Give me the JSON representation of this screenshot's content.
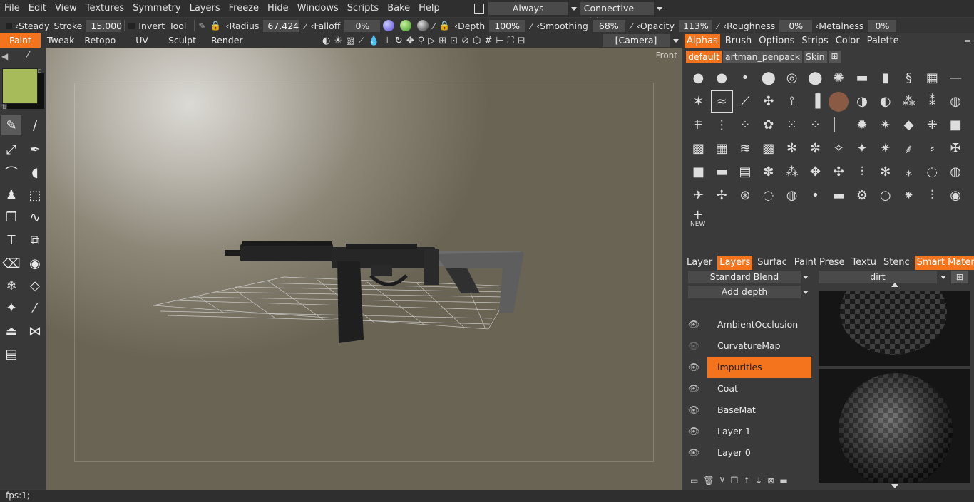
{
  "menubar": {
    "items": [
      "File",
      "Edit",
      "View",
      "Textures",
      "Symmetry",
      "Layers",
      "Freeze",
      "Hide",
      "Windows",
      "Scripts",
      "Bake",
      "Help"
    ],
    "always_label": "Always",
    "connective_label": "Connective Picki"
  },
  "toolbar": {
    "steady_label": "Steady",
    "stroke_label": "Stroke",
    "stroke_value": "15.000",
    "invert_label": "Invert",
    "tool_label": "Tool",
    "radius_label": "Radius",
    "radius_value": "67.424",
    "falloff_label": "Falloff",
    "falloff_value": "0%",
    "depth_label": "Depth",
    "depth_value": "100%",
    "smoothing_label": "Smoothing",
    "smoothing_value": "68%",
    "opacity_label": "Opacity",
    "opacity_value": "113%",
    "roughness_label": "Roughness",
    "roughness_value": "0%",
    "metalness_label": "Metalness",
    "metalness_value": "0%"
  },
  "modes": [
    "Paint",
    "Tweak",
    "Retopo",
    "UV",
    "Sculpt",
    "Render"
  ],
  "camera_label": "[Camera]",
  "viewport": {
    "view_label": "Front"
  },
  "color_swatch": "#a8bb5a",
  "alphas_panel": {
    "tabs": [
      "Alphas",
      "Brush",
      "Options",
      "Strips",
      "Color",
      "Palette"
    ],
    "subtabs": [
      "default",
      "artman_penpack",
      "Skin"
    ],
    "new_label": "NEW"
  },
  "layers_panel": {
    "tabs": [
      "Layer",
      "Layers",
      "Surfac",
      "Paint"
    ],
    "blend_mode": "Standard  Blend",
    "depth_mode": "Add  depth",
    "layers": [
      "AmbientOcclusion",
      "CurvatureMap",
      "impurities",
      "Coat",
      "BaseMat",
      "Layer  1",
      "Layer  0"
    ]
  },
  "smart_panel": {
    "tabs": [
      "Prese",
      "Textu",
      "Stenc",
      "Smart  Materials"
    ],
    "filter_value": "dirt"
  },
  "status": {
    "fps": "fps:1;"
  }
}
